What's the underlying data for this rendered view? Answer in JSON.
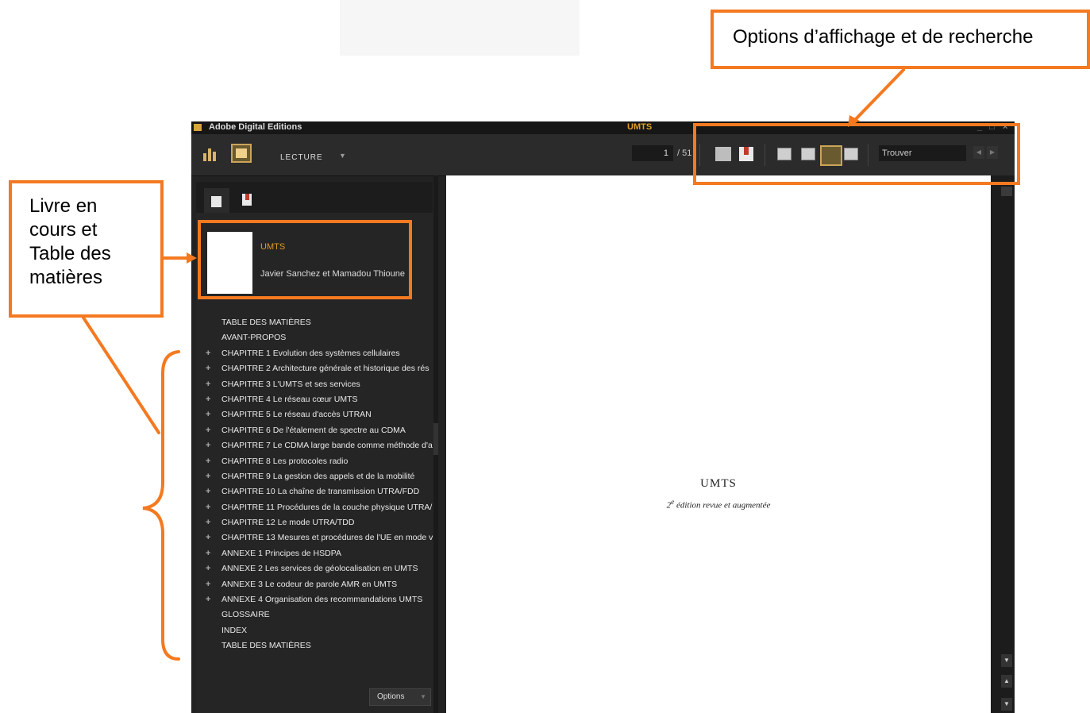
{
  "window": {
    "app_name": "Adobe Digital Editions",
    "document_title": "UMTS",
    "controls": [
      "_",
      "□",
      "×"
    ]
  },
  "toolbar": {
    "mode_label": "LECTURE",
    "current_page": "1",
    "total_pages": "/ 51",
    "search_placeholder": "Trouver"
  },
  "sidebar": {
    "current_book": {
      "title": "UMTS",
      "author": "Javier Sanchez et Mamadou Thioune"
    },
    "toc": [
      {
        "label": "TABLE DES MATIÈRES",
        "expandable": false
      },
      {
        "label": "AVANT-PROPOS",
        "expandable": false
      },
      {
        "label": "CHAPITRE 1 Evolution des systèmes cellulaires",
        "expandable": true
      },
      {
        "label": "CHAPITRE 2 Architecture générale et historique des rés",
        "expandable": true
      },
      {
        "label": "CHAPITRE 3 L'UMTS et ses services",
        "expandable": true
      },
      {
        "label": "CHAPITRE 4 Le réseau cœur UMTS",
        "expandable": true
      },
      {
        "label": "CHAPITRE 5 Le réseau d'accès UTRAN",
        "expandable": true
      },
      {
        "label": "CHAPITRE 6 De l'étalement de spectre au CDMA",
        "expandable": true
      },
      {
        "label": "CHAPITRE 7 Le CDMA large bande comme méthode d'ac",
        "expandable": true
      },
      {
        "label": "CHAPITRE 8 Les protocoles radio",
        "expandable": true
      },
      {
        "label": "CHAPITRE 9 La gestion des appels et de la mobilité",
        "expandable": true
      },
      {
        "label": "CHAPITRE 10 La chaîne de transmission UTRA/FDD",
        "expandable": true
      },
      {
        "label": "CHAPITRE 11 Procédures de la couche physique UTRA/",
        "expandable": true
      },
      {
        "label": "CHAPITRE 12 Le mode UTRA/TDD",
        "expandable": true
      },
      {
        "label": "CHAPITRE 13 Mesures et procédures de l'UE en mode v",
        "expandable": true
      },
      {
        "label": "ANNEXE 1 Principes de HSDPA",
        "expandable": true
      },
      {
        "label": "ANNEXE 2 Les services de géolocalisation en UMTS",
        "expandable": true
      },
      {
        "label": "ANNEXE 3 Le codeur de parole AMR en UMTS",
        "expandable": true
      },
      {
        "label": "ANNEXE 4 Organisation des recommandations UMTS",
        "expandable": true
      },
      {
        "label": "GLOSSAIRE",
        "expandable": false
      },
      {
        "label": "INDEX",
        "expandable": false
      },
      {
        "label": "TABLE DES MATIÈRES",
        "expandable": false
      }
    ],
    "options_label": "Options"
  },
  "page": {
    "book_title": "UMTS",
    "edition_sup": "2",
    "edition_text": "e",
    "subtitle_rest": " édition revue et augmentée"
  },
  "annotations": {
    "options_callout": "Options d’affichage et de recherche",
    "book_callout_lines": [
      "Livre en",
      "cours et",
      "Table des",
      "matières"
    ]
  },
  "colors": {
    "accent_orange": "#f47920",
    "title_gold": "#e09a20",
    "app_background": "#222222"
  }
}
